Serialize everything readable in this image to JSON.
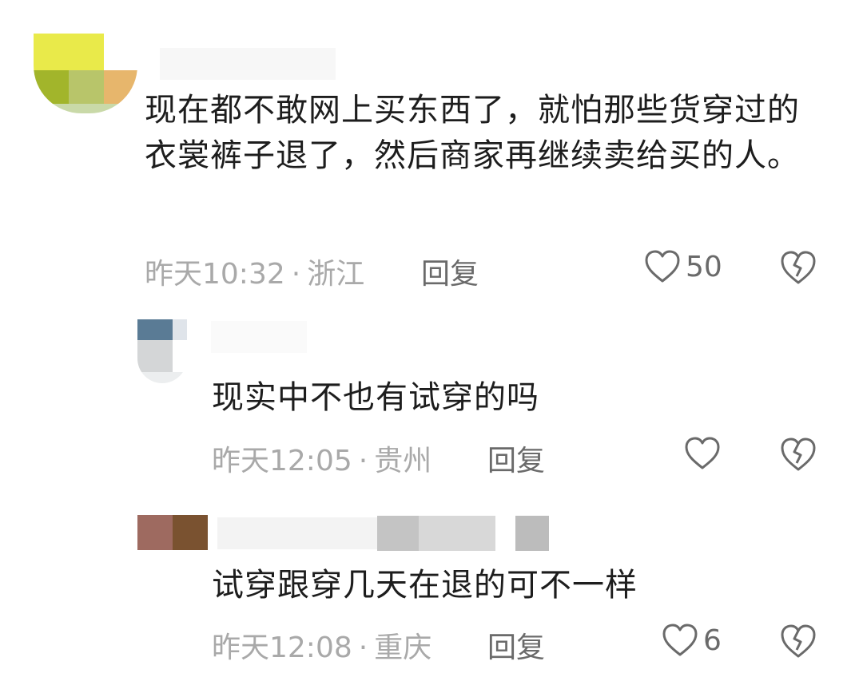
{
  "comments": [
    {
      "text": "现在都不敢网上买东西了，就怕那些货穿过的衣裳裤子退了，然后商家再继续卖给买的人。",
      "time": "昨天10:32",
      "location": "浙江",
      "reply_label": "回复",
      "like_count": "50"
    },
    {
      "text": "现实中不也有试穿的吗",
      "time": "昨天12:05",
      "location": "贵州",
      "reply_label": "回复",
      "like_count": ""
    },
    {
      "text": "试穿跟穿几天在退的可不一样",
      "time": "昨天12:08",
      "location": "重庆",
      "reply_label": "回复",
      "like_count": "6"
    }
  ],
  "separator": "·",
  "icons": {
    "like": "heart-outline-icon",
    "dislike": "broken-heart-icon"
  },
  "colors": {
    "meta": "#a9a9a9",
    "action": "#6a6a6a",
    "text": "#1d1d1d"
  }
}
